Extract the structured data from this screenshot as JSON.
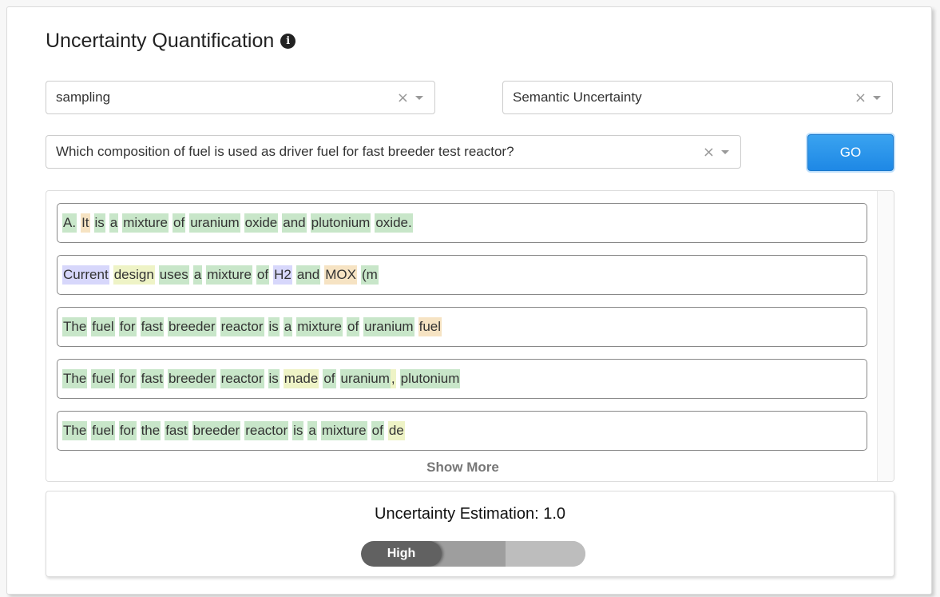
{
  "panel": {
    "title": "Uncertainty Quantification",
    "info_icon": "info-circle-icon"
  },
  "controls": {
    "method_select": {
      "value": "sampling",
      "clear": "×"
    },
    "metric_select": {
      "value": "Semantic Uncertainty",
      "clear": "×"
    },
    "question_select": {
      "value": "Which composition of fuel is used as driver fuel for fast breeder test reactor?",
      "clear": "×"
    },
    "go_label": "GO"
  },
  "colors": {
    "green": "#c8e6c9",
    "yellow": "#eef3c6",
    "orange": "#f6e3c3",
    "purple": "#d7d7fb",
    "accent": "#1e88e5"
  },
  "responses": [
    {
      "tokens": [
        {
          "t": "A.",
          "c": "g"
        },
        {
          "t": "It",
          "c": "o"
        },
        {
          "t": "is",
          "c": "g"
        },
        {
          "t": "a",
          "c": "g"
        },
        {
          "t": "mixture",
          "c": "g"
        },
        {
          "t": "of",
          "c": "g"
        },
        {
          "t": "uranium",
          "c": "g"
        },
        {
          "t": "oxide",
          "c": "g"
        },
        {
          "t": "and",
          "c": "g"
        },
        {
          "t": "plutonium",
          "c": "g"
        },
        {
          "t": "oxide.",
          "c": "g"
        }
      ]
    },
    {
      "tokens": [
        {
          "t": "Current",
          "c": "p"
        },
        {
          "t": "design",
          "c": "y"
        },
        {
          "t": "uses",
          "c": "g"
        },
        {
          "t": "a",
          "c": "g"
        },
        {
          "t": "mixture",
          "c": "g"
        },
        {
          "t": "of",
          "c": "g"
        },
        {
          "t": "H2",
          "c": "p"
        },
        {
          "t": "and",
          "c": "g"
        },
        {
          "t": "MOX",
          "c": "o"
        },
        {
          "t": "(m",
          "c": "g"
        }
      ]
    },
    {
      "tokens": [
        {
          "t": "The",
          "c": "g"
        },
        {
          "t": "fuel",
          "c": "g"
        },
        {
          "t": "for",
          "c": "g"
        },
        {
          "t": "fast",
          "c": "g"
        },
        {
          "t": "breeder",
          "c": "g"
        },
        {
          "t": "reactor",
          "c": "g"
        },
        {
          "t": "is",
          "c": "g"
        },
        {
          "t": "a",
          "c": "g"
        },
        {
          "t": "mixture",
          "c": "g"
        },
        {
          "t": "of",
          "c": "g"
        },
        {
          "t": "uranium",
          "c": "g"
        },
        {
          "t": "fuel",
          "c": "o"
        }
      ]
    },
    {
      "tokens": [
        {
          "t": "The",
          "c": "g"
        },
        {
          "t": "fuel",
          "c": "g"
        },
        {
          "t": "for",
          "c": "g"
        },
        {
          "t": "fast",
          "c": "g"
        },
        {
          "t": "breeder",
          "c": "g"
        },
        {
          "t": "reactor",
          "c": "g"
        },
        {
          "t": "is",
          "c": "g"
        },
        {
          "t": "made",
          "c": "y"
        },
        {
          "t": "of",
          "c": "g"
        },
        {
          "t": "uranium",
          "c": "g",
          "nm": true
        },
        {
          "t": ",",
          "c": "y"
        },
        {
          "t": "plutonium",
          "c": "g"
        }
      ]
    },
    {
      "tokens": [
        {
          "t": "The",
          "c": "g"
        },
        {
          "t": "fuel",
          "c": "g"
        },
        {
          "t": "for",
          "c": "g"
        },
        {
          "t": "the",
          "c": "g"
        },
        {
          "t": "fast",
          "c": "g"
        },
        {
          "t": "breeder",
          "c": "g"
        },
        {
          "t": "reactor",
          "c": "g"
        },
        {
          "t": "is",
          "c": "g"
        },
        {
          "t": "a",
          "c": "g"
        },
        {
          "t": "mixture",
          "c": "g"
        },
        {
          "t": "of",
          "c": "g"
        },
        {
          "t": "de",
          "c": "y"
        }
      ]
    }
  ],
  "show_more_label": "Show More",
  "estimation": {
    "label": "Uncertainty Estimation: 1.0",
    "level_label": "High",
    "level_index": 0,
    "levels": 3
  }
}
